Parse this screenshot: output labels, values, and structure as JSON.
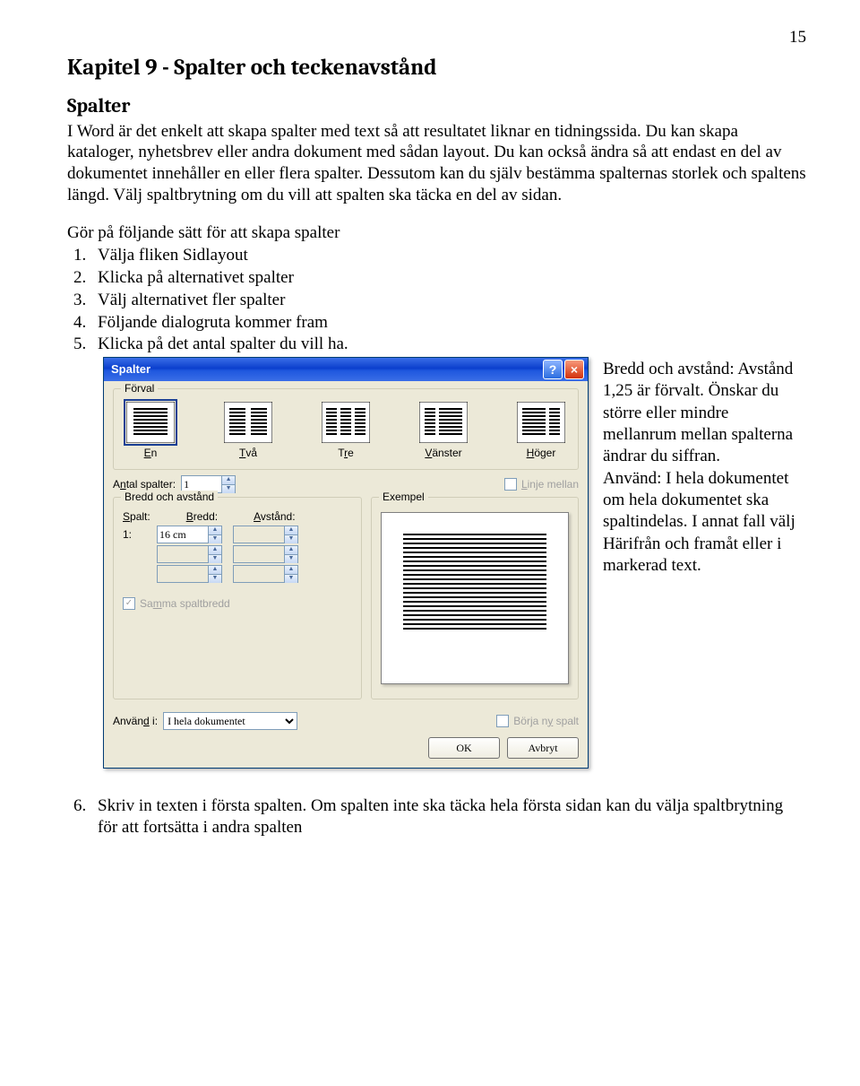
{
  "page_number": "15",
  "heading": "Kapitel 9 - Spalter och teckenavstånd",
  "subheading": "Spalter",
  "intro": "I Word är det enkelt att skapa spalter med text så att resultatet liknar en tidningssida. Du kan skapa kataloger, nyhetsbrev eller andra dokument med sådan layout. Du kan också ändra så att endast en del av dokumentet innehåller en eller flera spalter. Dessutom kan du själv bestämma spalternas storlek och spaltens längd. Välj spaltbrytning om du vill att spalten ska täcka en del av sidan.",
  "steps_title": "Gör på följande sätt för att skapa spalter",
  "steps": [
    "Välja fliken Sidlayout",
    "Klicka på alternativet spalter",
    "Välj alternativet fler spalter",
    "Följande dialogruta kommer fram",
    "Klicka på det antal spalter du vill ha."
  ],
  "side_text": "Bredd och avstånd: Avstånd 1,25 är förvalt. Önskar du större eller mindre mellanrum mellan spalterna ändrar du siffran.\nAnvänd: I hela dokumentet om hela dokumentet ska spaltindelas. I annat fall välj Härifrån och framåt eller i markerad text.",
  "step6": "Skriv in texten i första spalten. Om spalten inte ska täcka hela första sidan kan du välja spaltbrytning för att fortsätta i andra spalten",
  "dialog": {
    "title": "Spalter",
    "forval_legend": "Förval",
    "presets": {
      "one": "En",
      "two": "Två",
      "three": "Tre",
      "left": "Vänster",
      "right": "Höger"
    },
    "num_columns_label": "Antal spalter:",
    "num_columns_value": "1",
    "line_between": "Linje mellan",
    "width_legend": "Bredd och avstånd",
    "hdr_col": "Spalt:",
    "hdr_width": "Bredd:",
    "hdr_spacing": "Avstånd:",
    "row1_num": "1:",
    "row1_width": "16 cm",
    "same_width": "Samma spaltbredd",
    "exempel_legend": "Exempel",
    "apply_label": "Använd i:",
    "apply_value": "I hela dokumentet",
    "new_column": "Börja ny spalt",
    "ok": "OK",
    "cancel": "Avbryt"
  }
}
